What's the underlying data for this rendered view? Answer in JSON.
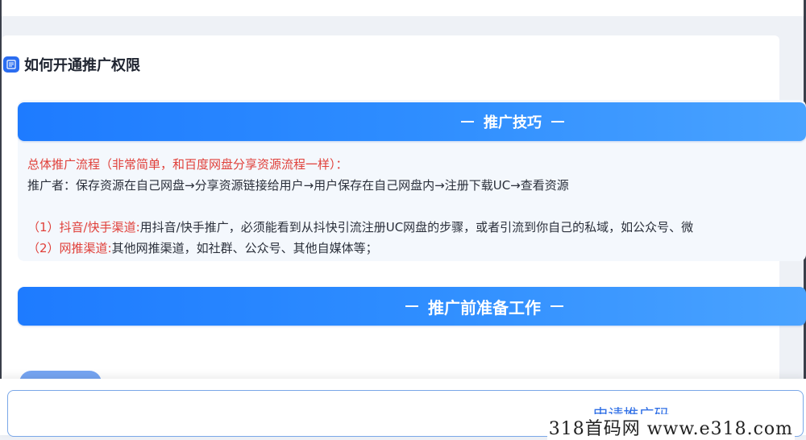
{
  "section": {
    "title": "如何开通推广权限",
    "icon": "doc-badge-icon",
    "accent": "#2b6df0"
  },
  "banners": {
    "tips": "推广技巧",
    "prep": "推广前准备工作",
    "color": "#1e7bff"
  },
  "tips": {
    "process_heading": "总体推广流程（非常简单，和百度网盘分享资源流程一样）：",
    "process_line": "推广者：保存资源在自己网盘→分享资源链接给用户→用户保存在自己网盘内→注册下载UC→查看资源",
    "channel1_label": "（1）抖音/快手渠道:",
    "channel1_text": "用抖音/快手推广，必须能看到从抖快引流注册UC网盘的步骤，或者引流到你自己的私域，如公众号、微",
    "channel2_label": "（2）网推渠道:",
    "channel2_text": "其他网推渠道，如社群、公众号、其他自媒体等；"
  },
  "footer": {
    "apply_button": "申请推广码",
    "watermark": "318首码网 www.e318.com"
  }
}
